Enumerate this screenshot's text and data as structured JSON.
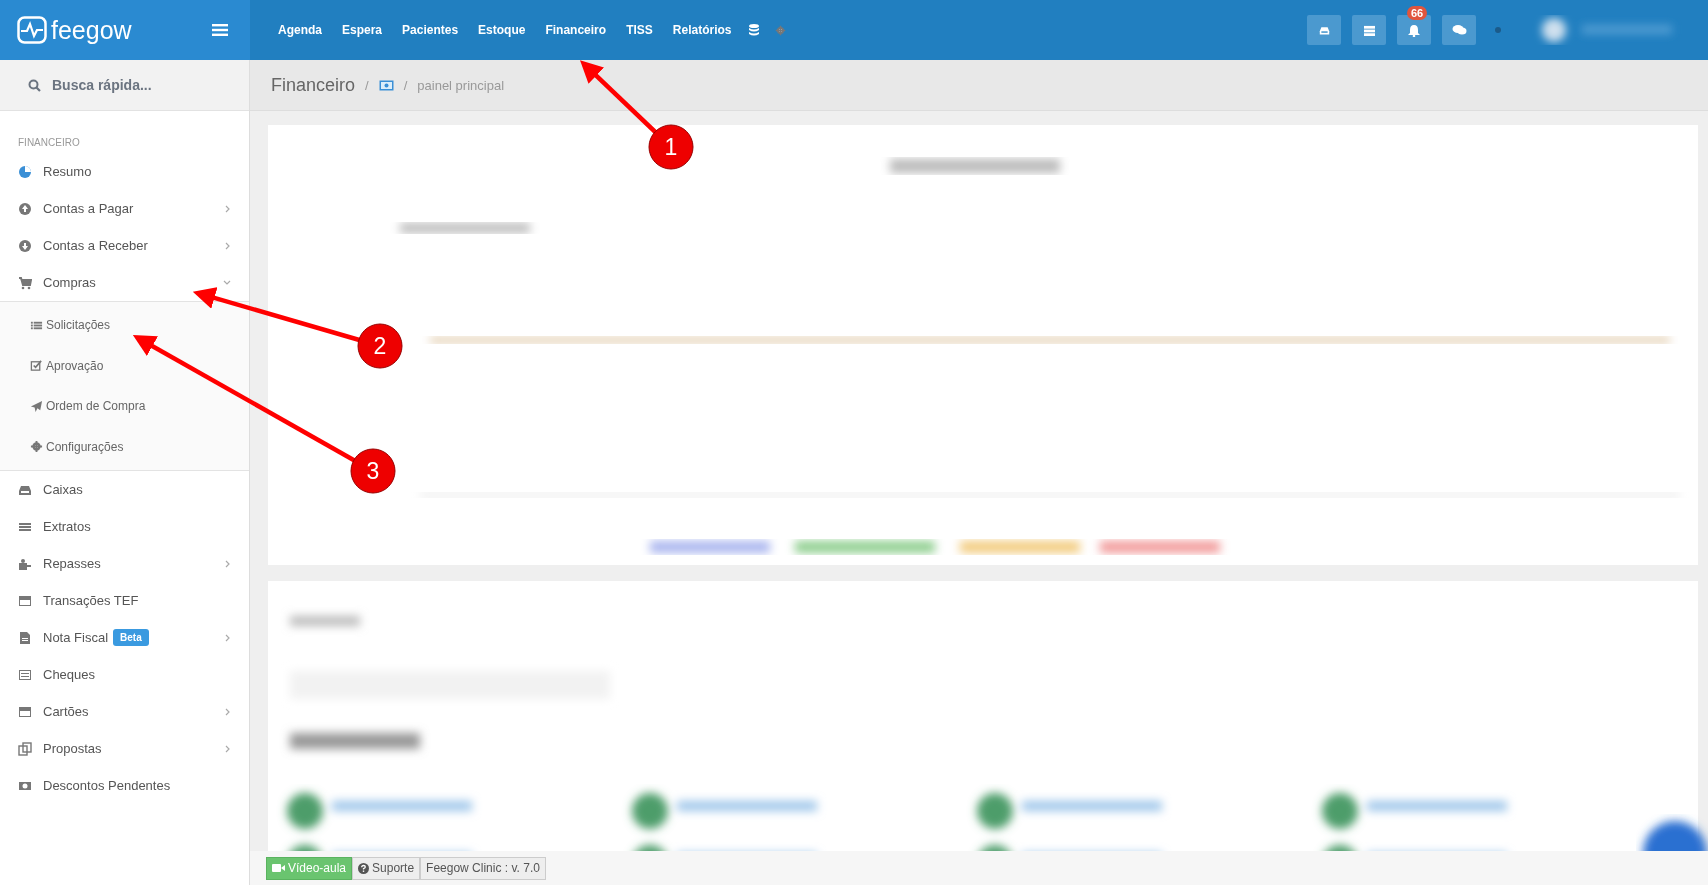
{
  "brand": {
    "name": "feegow"
  },
  "nav": [
    {
      "label": "Agenda"
    },
    {
      "label": "Espera"
    },
    {
      "label": "Pacientes"
    },
    {
      "label": "Estoque"
    },
    {
      "label": "Financeiro"
    },
    {
      "label": "TISS"
    },
    {
      "label": "Relatórios"
    }
  ],
  "notification_badge": "66",
  "search": {
    "placeholder": "Busca rápida..."
  },
  "breadcrumb": {
    "title": "Financeiro",
    "separators": [
      "/",
      "/"
    ],
    "current": "painel principal"
  },
  "sidebar": {
    "section": "FINANCEIRO",
    "items": [
      {
        "label": "Resumo",
        "has_submenu": false
      },
      {
        "label": "Contas a Pagar",
        "has_submenu": true
      },
      {
        "label": "Contas a Receber",
        "has_submenu": true
      },
      {
        "label": "Compras",
        "has_submenu": true,
        "expanded": true,
        "children": [
          {
            "label": "Solicitações"
          },
          {
            "label": "Aprovação"
          },
          {
            "label": "Ordem de Compra"
          },
          {
            "label": "Configurações"
          }
        ]
      },
      {
        "label": "Caixas",
        "has_submenu": false
      },
      {
        "label": "Extratos",
        "has_submenu": false
      },
      {
        "label": "Repasses",
        "has_submenu": true
      },
      {
        "label": "Transações TEF",
        "has_submenu": false
      },
      {
        "label": "Nota Fiscal",
        "has_submenu": true,
        "badge": "Beta"
      },
      {
        "label": "Cheques",
        "has_submenu": false
      },
      {
        "label": "Cartões",
        "has_submenu": true
      },
      {
        "label": "Propostas",
        "has_submenu": true
      },
      {
        "label": "Descontos Pendentes",
        "has_submenu": false
      }
    ]
  },
  "footer": {
    "video": "Vídeo-aula",
    "support": "Suporte",
    "version": "Feegow Clinic : v. 7.0"
  },
  "annotations": [
    {
      "number": "1"
    },
    {
      "number": "2"
    },
    {
      "number": "3"
    }
  ]
}
